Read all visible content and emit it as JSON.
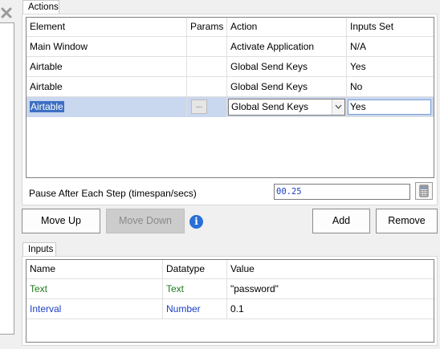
{
  "actions_tab": "Actions",
  "inputs_tab": "Inputs",
  "actions_grid": {
    "headers": [
      "Element",
      "Params",
      "Action",
      "Inputs Set"
    ],
    "rows": [
      {
        "element": "Main Window",
        "params": "",
        "action": "Activate Application",
        "inputs_set": "N/A"
      },
      {
        "element": "Airtable",
        "params": "",
        "action": "Global Send Keys",
        "inputs_set": "Yes"
      },
      {
        "element": "Airtable",
        "params": "",
        "action": "Global Send Keys",
        "inputs_set": "No"
      },
      {
        "element": "Airtable",
        "params": "...",
        "action": "Global Send Keys",
        "inputs_set": "Yes"
      }
    ]
  },
  "pause": {
    "label": "Pause After Each Step (timespan/secs)",
    "value": "00.25"
  },
  "buttons": {
    "move_up": "Move Up",
    "move_down": "Move Down",
    "add": "Add",
    "remove": "Remove"
  },
  "inputs_grid": {
    "headers": [
      "Name",
      "Datatype",
      "Value"
    ],
    "rows": [
      {
        "name": "Text",
        "datatype": "Text",
        "value": "\"password\""
      },
      {
        "name": "Interval",
        "datatype": "Number",
        "value": "0.1"
      }
    ]
  },
  "colors": {
    "selection": "#3d6fc4",
    "selected_row": "#c9d7ef",
    "green_text": "#1d7a1d",
    "blue_text": "#1b3fc4",
    "info_icon": "#2a6fd6"
  }
}
